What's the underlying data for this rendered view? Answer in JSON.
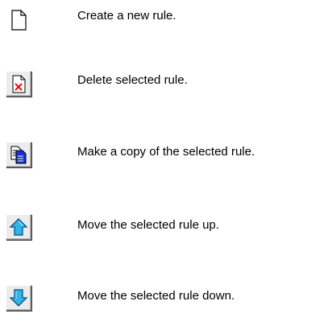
{
  "toolbar_help": {
    "items": [
      {
        "icon": "new-document-icon",
        "description": "Create a new rule."
      },
      {
        "icon": "delete-document-icon",
        "description": "Delete selected rule."
      },
      {
        "icon": "copy-documents-icon",
        "description": "Make a copy of the selected rule."
      },
      {
        "icon": "arrow-up-icon",
        "description": "Move the selected rule up."
      },
      {
        "icon": "arrow-down-icon",
        "description": "Move the selected rule down."
      }
    ]
  },
  "colors": {
    "arrow_fill": "#2fb6e8",
    "arrow_outline": "#0a4f8a",
    "delete_x": "#e01010",
    "copy_front": "#1a2fd0"
  }
}
